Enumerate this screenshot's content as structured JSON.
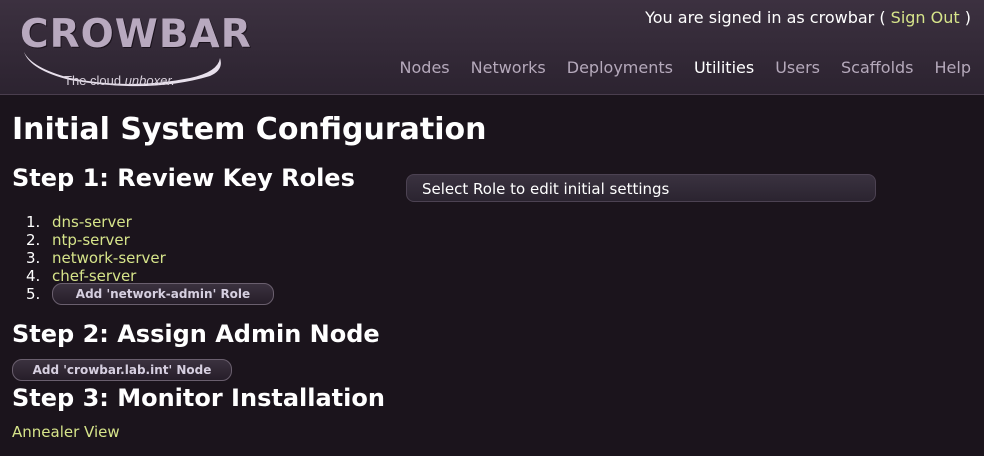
{
  "brand": {
    "name": "CROWBAR",
    "tagline_prefix": "The cloud ",
    "tagline_em": "unboxer."
  },
  "user_bar": {
    "prefix": "You are signed in as crowbar (",
    "signout": "Sign Out",
    "suffix": ")"
  },
  "nav": {
    "items": [
      "Nodes",
      "Networks",
      "Deployments",
      "Utilities",
      "Users",
      "Scaffolds",
      "Help"
    ],
    "active": "Utilities"
  },
  "page": {
    "title": "Initial System Configuration",
    "step1": {
      "title": "Step 1: Review Key Roles",
      "roles": [
        "dns-server",
        "ntp-server",
        "network-server",
        "chef-server"
      ],
      "numbers": [
        "1.",
        "2.",
        "3.",
        "4.",
        "5."
      ],
      "add_role_button": "Add 'network-admin' Role"
    },
    "step2": {
      "title": "Step 2: Assign Admin Node",
      "add_node_button": "Add 'crowbar.lab.int' Node"
    },
    "step3": {
      "title": "Step 3: Monitor Installation",
      "link": "Annealer View"
    },
    "panel_text": "Select Role to edit initial settings"
  },
  "colors": {
    "background": "#1b141c",
    "header": "#3c3140",
    "link": "#d6e48a",
    "nav_inactive": "#b5a9bb",
    "nav_active": "#ffffff"
  }
}
